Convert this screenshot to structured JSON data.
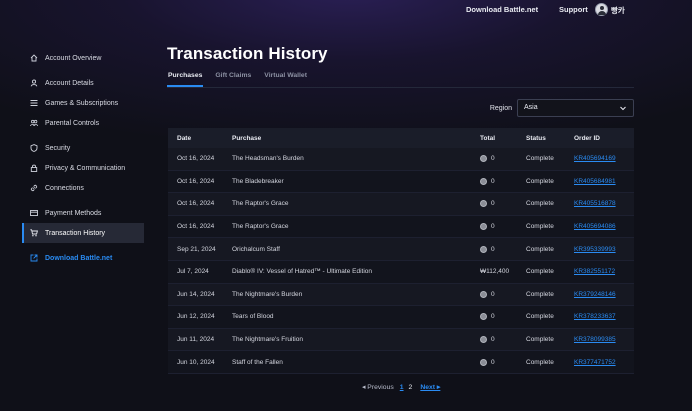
{
  "topbar": {
    "download_label": "Download Battle.net",
    "support_label": "Support",
    "username": "빵카"
  },
  "sidebar": {
    "items": [
      {
        "label": "Account Overview",
        "icon": "home-icon"
      },
      {
        "label": "Account Details",
        "icon": "user-icon"
      },
      {
        "label": "Games & Subscriptions",
        "icon": "list-icon"
      },
      {
        "label": "Parental Controls",
        "icon": "users-icon"
      },
      {
        "label": "Security",
        "icon": "shield-icon"
      },
      {
        "label": "Privacy & Communication",
        "icon": "lock-icon"
      },
      {
        "label": "Connections",
        "icon": "link-icon"
      },
      {
        "label": "Payment Methods",
        "icon": "credit-card-icon"
      },
      {
        "label": "Transaction History",
        "icon": "cart-icon"
      },
      {
        "label": "Download Battle.net",
        "icon": "external-link-icon"
      }
    ]
  },
  "main": {
    "title": "Transaction History",
    "tabs": [
      "Purchases",
      "Gift Claims",
      "Virtual Wallet"
    ],
    "region_label": "Region",
    "region_value": "Asia"
  },
  "table": {
    "headers": [
      "Date",
      "Purchase",
      "Total",
      "Status",
      "Order ID"
    ],
    "rows": [
      {
        "date": "Oct 16, 2024",
        "purchase": "The Headsman's Burden",
        "total": "0",
        "status": "Complete",
        "order": "KR405694169",
        "coin": true
      },
      {
        "date": "Oct 16, 2024",
        "purchase": "The Bladebreaker",
        "total": "0",
        "status": "Complete",
        "order": "KR405684981",
        "coin": true
      },
      {
        "date": "Oct 16, 2024",
        "purchase": "The Raptor's Grace",
        "total": "0",
        "status": "Complete",
        "order": "KR405516878",
        "coin": true
      },
      {
        "date": "Oct 16, 2024",
        "purchase": "The Raptor's Grace",
        "total": "0",
        "status": "Complete",
        "order": "KR405694086",
        "coin": true
      },
      {
        "date": "Sep 21, 2024",
        "purchase": "Orichalcum Staff",
        "total": "0",
        "status": "Complete",
        "order": "KR395339993",
        "coin": true
      },
      {
        "date": "Jul 7, 2024",
        "purchase": "Diablo® IV: Vessel of Hatred™ - Ultimate Edition",
        "total": "₩112,400",
        "status": "Complete",
        "order": "KR382551172",
        "coin": false
      },
      {
        "date": "Jun 14, 2024",
        "purchase": "The Nightmare's Burden",
        "total": "0",
        "status": "Complete",
        "order": "KR379248146",
        "coin": true
      },
      {
        "date": "Jun 12, 2024",
        "purchase": "Tears of Blood",
        "total": "0",
        "status": "Complete",
        "order": "KR378233637",
        "coin": true
      },
      {
        "date": "Jun 11, 2024",
        "purchase": "The Nightmare's Fruition",
        "total": "0",
        "status": "Complete",
        "order": "KR378099385",
        "coin": true
      },
      {
        "date": "Jun 10, 2024",
        "purchase": "Staff of the Fallen",
        "total": "0",
        "status": "Complete",
        "order": "KR377471752",
        "coin": true
      }
    ]
  },
  "pagination": {
    "prev_label": "◂ Previous",
    "pages": [
      "1",
      "2"
    ],
    "current_page": "1",
    "next_label": "Next ▸"
  },
  "colors": {
    "accent": "#2a8bf2",
    "background": "#0f1018"
  }
}
